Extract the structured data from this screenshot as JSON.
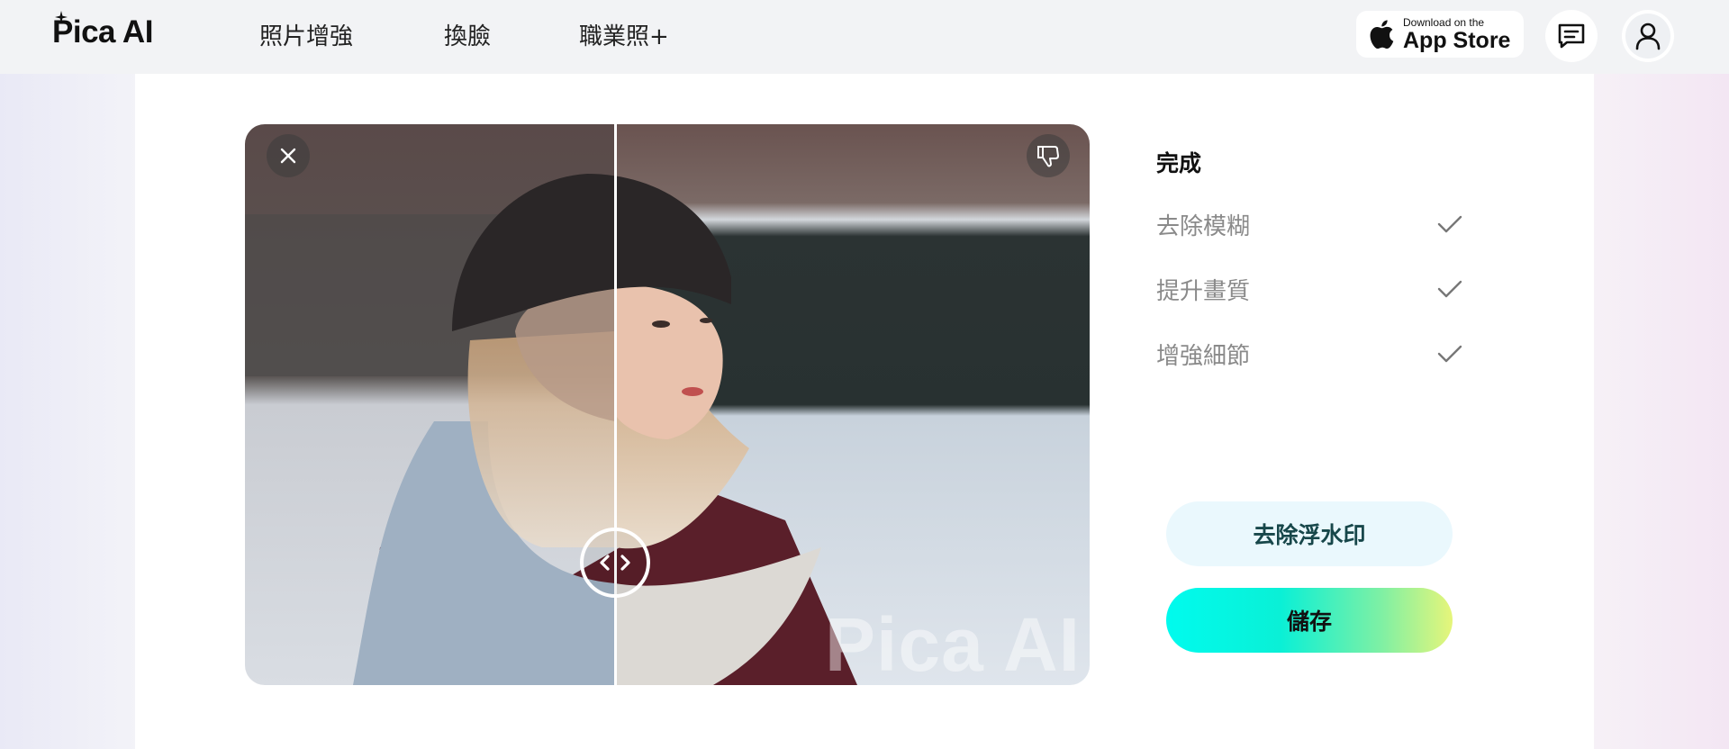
{
  "header": {
    "logo_text": "Pica AI",
    "nav": [
      {
        "label": "照片增強"
      },
      {
        "label": "換臉"
      },
      {
        "label": "職業照+"
      }
    ],
    "appstore": {
      "small": "Download on the",
      "big": "App Store"
    }
  },
  "compare": {
    "watermark": "Pica AI"
  },
  "status": {
    "title": "完成",
    "steps": [
      {
        "label": "去除模糊"
      },
      {
        "label": "提升畫質"
      },
      {
        "label": "增強細節"
      }
    ]
  },
  "actions": {
    "remove_watermark": "去除浮水印",
    "save": "儲存"
  },
  "colors": {
    "accent_start": "#00fbee",
    "accent_end": "#e6f57a",
    "step_text": "#8a8a8a"
  },
  "icons": [
    "sparkle-icon",
    "apple-icon",
    "message-icon",
    "user-icon",
    "close-icon",
    "thumbs-down-icon",
    "chevron-left-icon",
    "chevron-right-icon",
    "check-icon"
  ]
}
